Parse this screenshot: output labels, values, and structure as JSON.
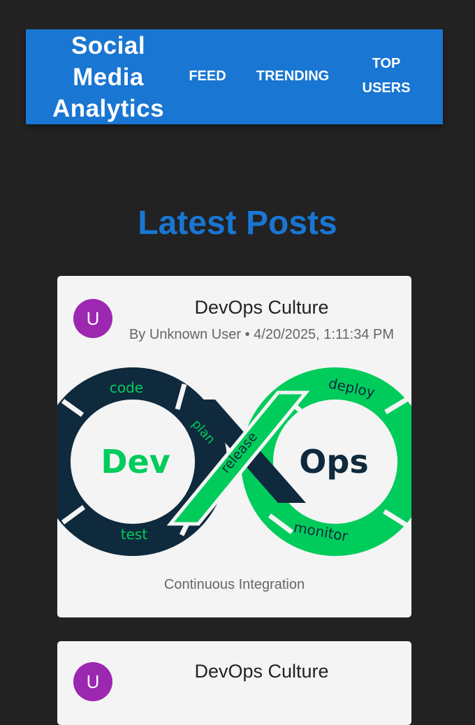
{
  "header": {
    "brand_line1": "Social",
    "brand_line2": "Media",
    "brand_line3": "Analytics",
    "nav_feed": "FEED",
    "nav_trending": "TRENDING",
    "nav_top_line1": "TOP",
    "nav_top_line2": "USERS"
  },
  "main": {
    "title": "Latest Posts"
  },
  "posts": [
    {
      "avatar_letter": "U",
      "title": "DevOps Culture",
      "meta": "By Unknown User • 4/20/2025, 1:11:34 PM",
      "caption": "Continuous Integration",
      "image": {
        "left_word": "Dev",
        "right_word": "Ops",
        "labels": [
          "code",
          "plan",
          "release",
          "test",
          "deploy",
          "monitor"
        ]
      }
    },
    {
      "avatar_letter": "U",
      "title": "DevOps Culture"
    }
  ],
  "colors": {
    "background": "#222222",
    "accent": "#1976d2",
    "avatar": "#9c27b0",
    "card": "#f4f4f4",
    "devops_navy": "#0f2a3d",
    "devops_green": "#00cc5c"
  }
}
